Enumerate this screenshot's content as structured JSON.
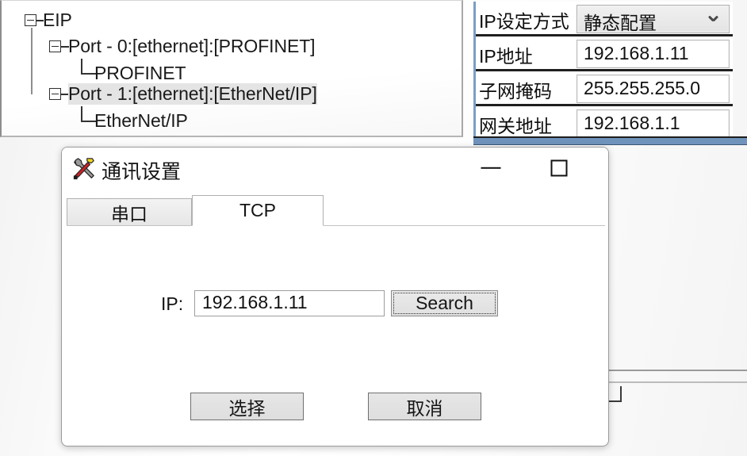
{
  "tree": {
    "nodes": [
      {
        "label": "EIP",
        "depth": 0,
        "expander": "minus",
        "selected": false
      },
      {
        "label": "Port - 0:[ethernet]:[PROFINET]",
        "depth": 1,
        "expander": "minus",
        "selected": false
      },
      {
        "label": "PROFINET",
        "depth": 2,
        "expander": "leaf",
        "selected": false
      },
      {
        "label": "Port - 1:[ethernet]:[EtherNet/IP]",
        "depth": 1,
        "expander": "minus",
        "selected": true
      },
      {
        "label": "EtherNet/IP",
        "depth": 2,
        "expander": "leaf",
        "selected": false
      }
    ]
  },
  "properties": {
    "rows": [
      {
        "label": "IP设定方式",
        "value": "静态配置",
        "control": "combobox"
      },
      {
        "label": "IP地址",
        "value": "192.168.1.11",
        "control": "textbox"
      },
      {
        "label": "子网掩码",
        "value": "255.255.255.0",
        "control": "textbox"
      },
      {
        "label": "网关地址",
        "value": "192.168.1.1",
        "control": "textbox"
      }
    ],
    "accent_color": "#6f93bb"
  },
  "dialog": {
    "title": "通讯设置",
    "icon": "hammer-wrench-icon",
    "window_controls": {
      "minimize": "−",
      "maximize": "▢",
      "close": "✕"
    },
    "tabs": [
      {
        "label": "串口",
        "active": false
      },
      {
        "label": "TCP",
        "active": true
      }
    ],
    "form": {
      "ip_label": "IP:",
      "ip_value": "192.168.1.11",
      "ip_placeholder": "",
      "search_label": "Search"
    },
    "footer": {
      "confirm_label": "选择",
      "cancel_label": "取消"
    }
  }
}
